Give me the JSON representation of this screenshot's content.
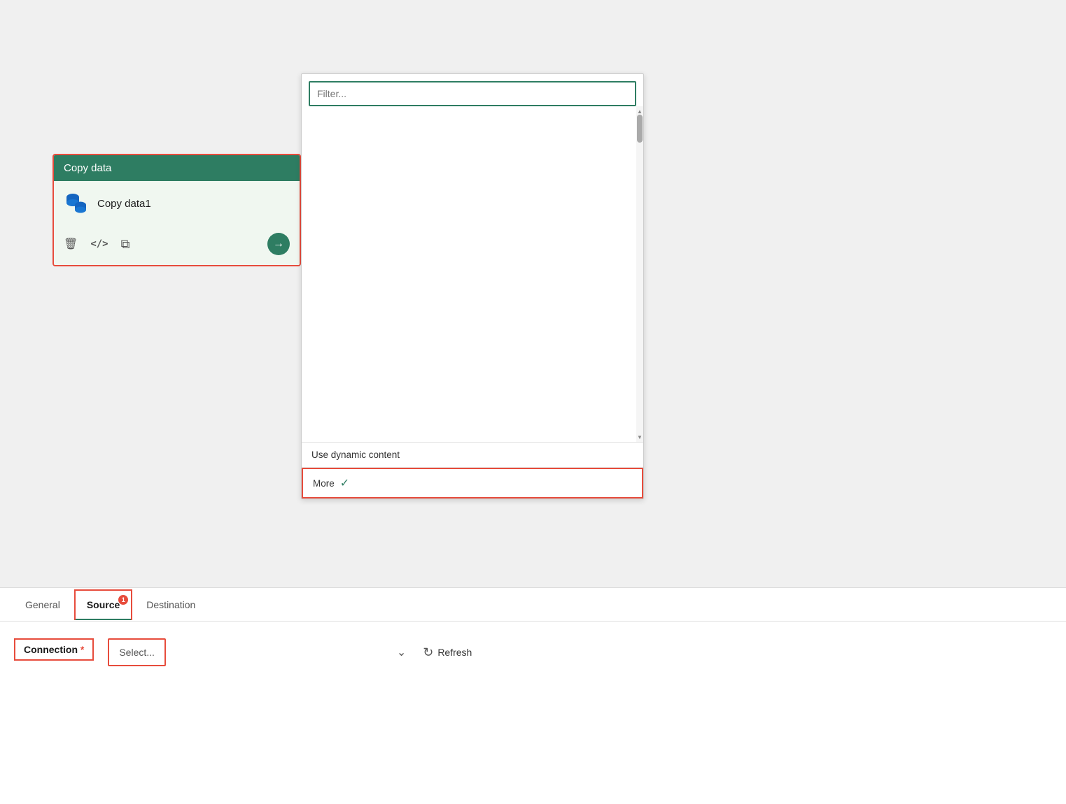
{
  "canvas": {
    "background": "#f0f0f0"
  },
  "copy_data_card": {
    "header": "Copy data",
    "item_name": "Copy data1",
    "delete_icon": "🗑",
    "code_icon": "</>",
    "copy_icon": "⧉"
  },
  "dropdown_panel": {
    "filter_placeholder": "Filter...",
    "dynamic_content_label": "Use dynamic content",
    "more_label": "More"
  },
  "tabs": {
    "general_label": "General",
    "source_label": "Source",
    "source_badge": "1",
    "destination_label": "Destination"
  },
  "connection": {
    "label": "Connection",
    "required": "*",
    "select_placeholder": "Select...",
    "refresh_label": "Refresh"
  }
}
